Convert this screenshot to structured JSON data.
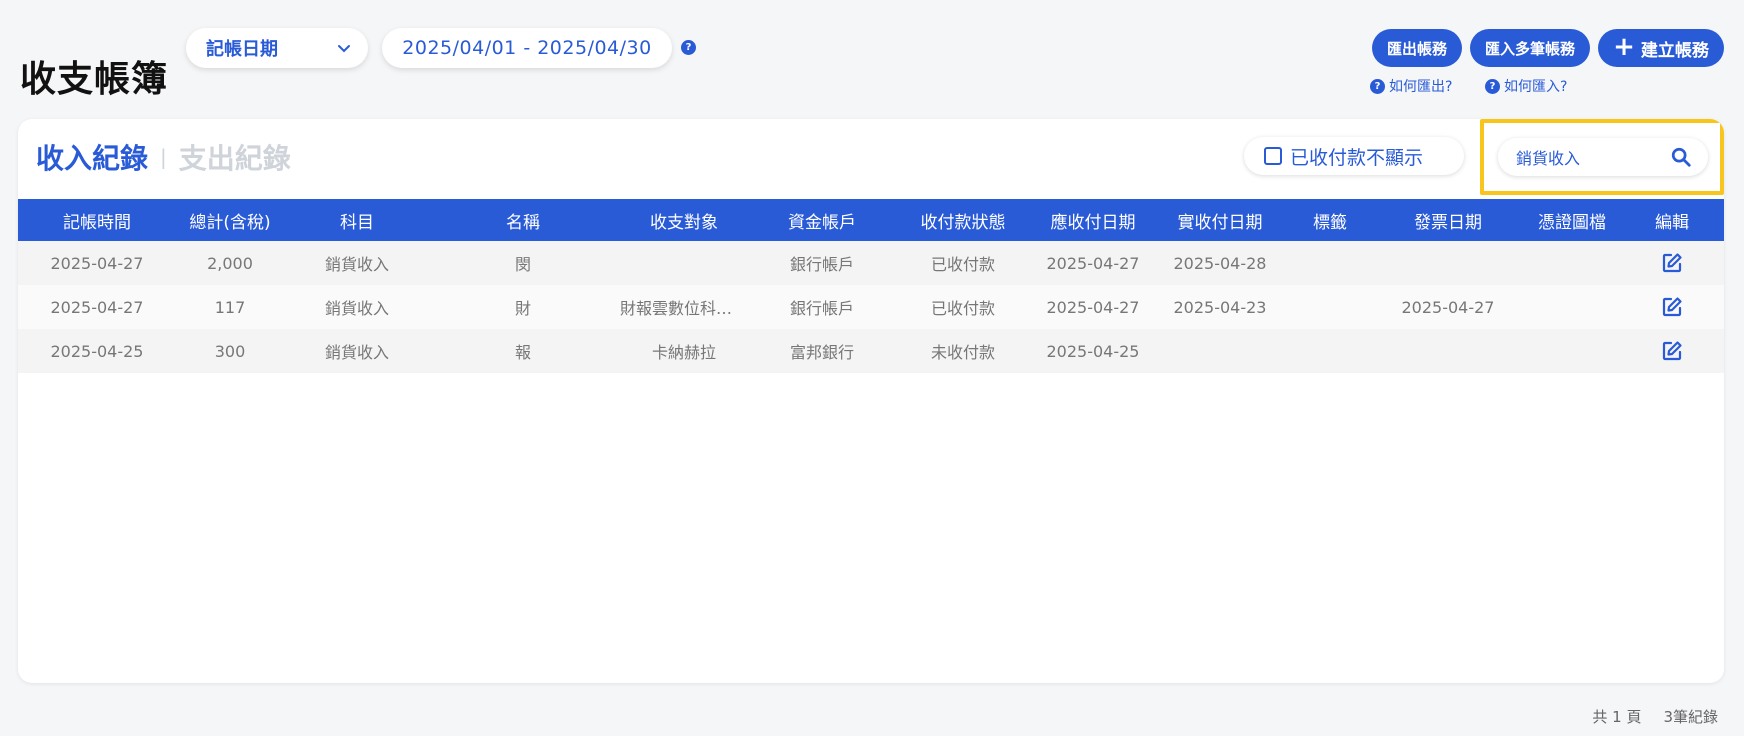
{
  "page": {
    "title": "收支帳簿"
  },
  "filters": {
    "date_type": "記帳日期",
    "date_range": "2025/04/01 - 2025/04/30",
    "help": "?"
  },
  "actions": {
    "export_label": "匯出帳務",
    "import_label": "匯入多筆帳務",
    "create_label": "建立帳務",
    "help_export": "如何匯出?",
    "help_import": "如何匯入?"
  },
  "tabs": {
    "income": "收入紀錄",
    "separator": "|",
    "expense": "支出紀錄"
  },
  "controls": {
    "hide_paid_label": "已收付款不顯示"
  },
  "search": {
    "value": "銷貨收入"
  },
  "table": {
    "columns": [
      "記帳時間",
      "總計(含稅)",
      "科目",
      "名稱",
      "收支對象",
      "資金帳戶",
      "收付款狀態",
      "應收付日期",
      "實收付日期",
      "標籤",
      "發票日期",
      "憑證圖檔",
      "編輯"
    ],
    "rows": [
      [
        "2025-04-27",
        "2,000",
        "銷貨收入",
        "閔",
        "",
        "銀行帳戶",
        "已收付款",
        "2025-04-27",
        "2025-04-28",
        "",
        "",
        "",
        ""
      ],
      [
        "2025-04-27",
        "117",
        "銷貨收入",
        "財",
        "財報雲數位科技股份有限公司",
        "銀行帳戶",
        "已收付款",
        "2025-04-27",
        "2025-04-23",
        "",
        "2025-04-27",
        "",
        ""
      ],
      [
        "2025-04-25",
        "300",
        "銷貨收入",
        "報",
        "卡納赫拉",
        "富邦銀行",
        "未收付款",
        "2025-04-25",
        "",
        "",
        "",
        "",
        ""
      ]
    ]
  },
  "footer": {
    "pages": "共 1 頁",
    "records": "3筆紀錄"
  },
  "colors": {
    "primary": "#2a5bd7",
    "highlight": "#f7c51b"
  }
}
